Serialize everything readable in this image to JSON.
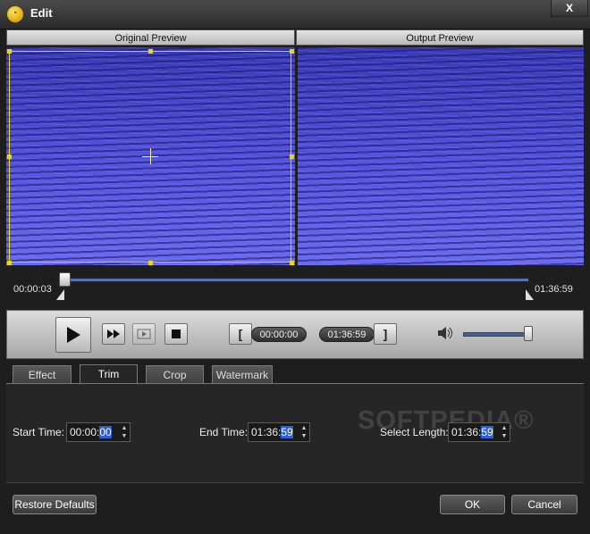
{
  "window": {
    "title": "Edit",
    "close_label": "X"
  },
  "preview": {
    "original_label": "Original Preview",
    "output_label": "Output Preview"
  },
  "timeline": {
    "current_time": "00:00:03",
    "end_time": "01:36:59",
    "position_fraction": 0.0005
  },
  "controls": {
    "play_icon": "play-icon",
    "next_frame_icon": "fast-forward-icon",
    "frame_step_icon": "frame-step-icon",
    "stop_icon": "stop-icon",
    "set_start_label": "[",
    "start_time": "00:00:00",
    "end_time": "01:36:59",
    "set_end_label": "]",
    "volume_icon": "speaker-icon",
    "volume_fraction": 0.95
  },
  "tabs": [
    {
      "label": "Effect",
      "active": false
    },
    {
      "label": "Trim",
      "active": true
    },
    {
      "label": "Crop",
      "active": false
    },
    {
      "label": "Watermark",
      "active": false
    }
  ],
  "trim": {
    "start_label": "Start Time:",
    "start_value_prefix": "00:00:",
    "start_value_selected": "00",
    "end_label": "End Time:",
    "end_value_prefix": "01:36:",
    "end_value_selected": "59",
    "length_label": "Select Length:",
    "length_value_prefix": "01:36:",
    "length_value_selected": "59"
  },
  "watermark_overlay": "SOFTPEDIA®",
  "buttons": {
    "restore_defaults": "Restore Defaults",
    "ok": "OK",
    "cancel": "Cancel"
  },
  "colors": {
    "crop_border": "#e6d820",
    "selection": "#2d5fd0",
    "timeline_track": "#5a6fb0"
  }
}
